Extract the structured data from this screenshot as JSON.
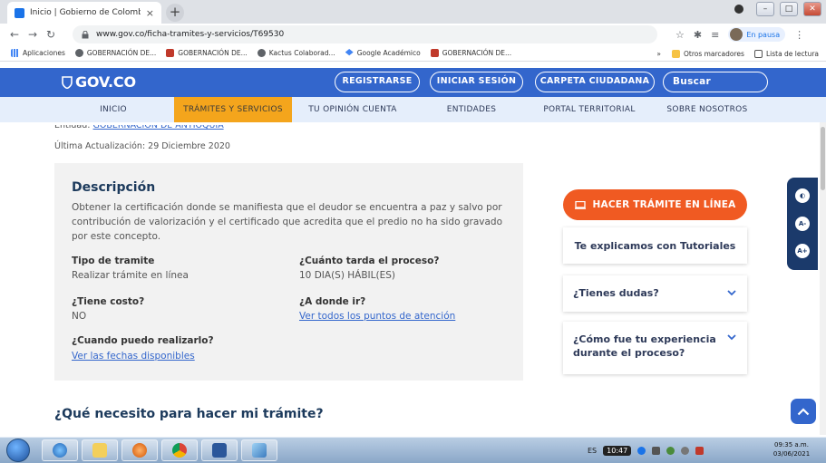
{
  "browser": {
    "tab_title": "Inicio | Gobierno de Colombia",
    "tab_close": "×",
    "new_tab": "+",
    "url": "www.gov.co/ficha-tramites-y-servicios/T69530",
    "profile_status": "En pausa",
    "bookmarks": [
      "Aplicaciones",
      "GOBERNACIÓN DE...",
      "GOBERNACIÓN DE...",
      "Kactus Colaborad...",
      "Google Académico",
      "GOBERNACIÓN DE..."
    ],
    "bookmarks_more": "»",
    "other_bookmarks": "Otros marcadores",
    "reading_list": "Lista de lectura"
  },
  "header": {
    "logo": "GOV.CO",
    "register_label": "REGISTRARSE",
    "login_label": "INICIAR SESIÓN",
    "folder_label": "CARPETA CIUDADANA",
    "search_placeholder": "Buscar"
  },
  "menu": {
    "items": [
      "INICIO",
      "TRÁMITES Y SERVICIOS",
      "TU OPINIÓN CUENTA",
      "ENTIDADES",
      "PORTAL TERRITORIAL",
      "SOBRE NOSOTROS"
    ],
    "active": "TRÁMITES Y SERVICIOS"
  },
  "content": {
    "entity_label": "Entidad:",
    "entity_value": "GOBERNACIÓN DE ANTIOQUIA",
    "updated": "Última Actualización: 29 Diciembre 2020",
    "description_title": "Descripción",
    "description_text": "Obtener la certificación donde se manifiesta que el deudor se encuentra a paz y salvo por contribución de valorización y el certificado que acredita que el predio no ha sido gravado por este concepto.",
    "fields": {
      "tipo_label": "Tipo de tramite",
      "tipo_value": "Realizar trámite en línea",
      "tarda_label": "¿Cuánto tarda el proceso?",
      "tarda_value": "10 DIA(S) HÁBIL(ES)",
      "costo_label": "¿Tiene costo?",
      "costo_value": "NO",
      "donde_label": "¿A donde ir?",
      "donde_link": "Ver todos los puntos de atención",
      "cuando_label": "¿Cuando puedo realizarlo?",
      "cuando_link": "Ver las fechas disponibles"
    },
    "section_title": "¿Qué necesito para hacer mi trámite?"
  },
  "sidebar": {
    "action_button": "HACER TRÁMITE EN LÍNEA",
    "tutorials": "Te explicamos con Tutoriales",
    "doubts": "¿Tienes dudas?",
    "experience_line1": "¿Cómo fue tu experiencia",
    "experience_line2": "durante el proceso?"
  },
  "accessibility": {
    "contrast": "◐",
    "font_decrease": "A-",
    "font_increase": "A+"
  },
  "taskbar": {
    "language": "ES",
    "counter": "10:47",
    "time": "09:35 a.m.",
    "date": "03/06/2021"
  },
  "colors": {
    "gov_blue": "#3366cc",
    "menu_active": "#f4a51c",
    "action_orange": "#f05a22",
    "title_navy": "#1c3a5c"
  }
}
